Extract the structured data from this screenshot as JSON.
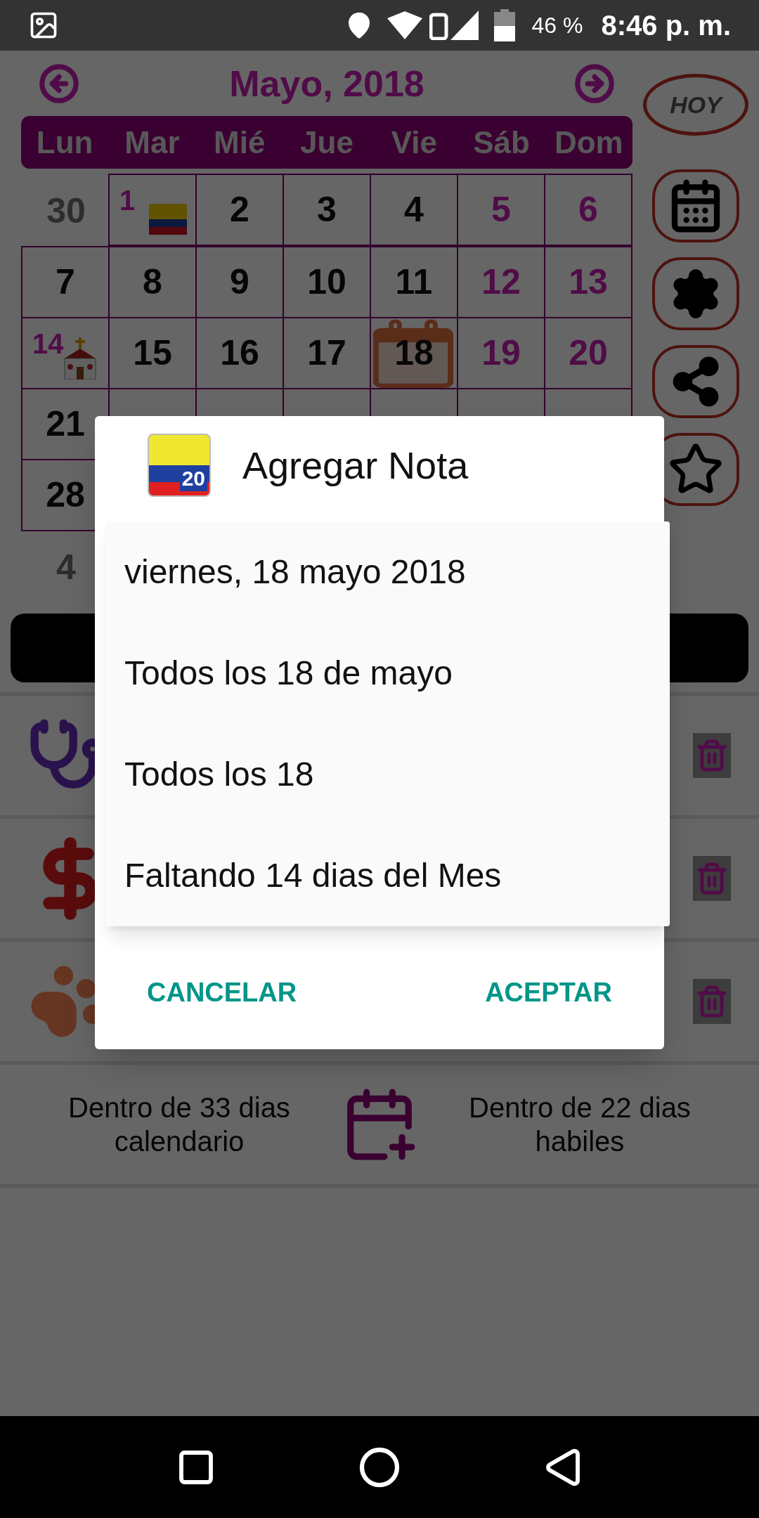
{
  "status_bar": {
    "battery": "46 %",
    "time": "8:46 p. m."
  },
  "calendar": {
    "title": "Mayo, 2018",
    "today_button": "HOY",
    "weekdays": [
      "Lun",
      "Mar",
      "Mié",
      "Jue",
      "Vie",
      "Sáb",
      "Dom"
    ],
    "weeks": [
      {
        "cells": [
          {
            "day": "30",
            "kind": "other-month",
            "selected": false
          },
          {
            "day": "1",
            "kind": "national-holiday",
            "selected": false
          },
          {
            "day": "2",
            "kind": "weekday",
            "selected": false
          },
          {
            "day": "3",
            "kind": "weekday",
            "selected": false
          },
          {
            "day": "4",
            "kind": "weekday",
            "selected": false
          },
          {
            "day": "5",
            "kind": "weekend",
            "selected": false
          },
          {
            "day": "6",
            "kind": "weekend",
            "selected": false
          }
        ]
      },
      {
        "cells": [
          {
            "day": "7",
            "kind": "weekday",
            "selected": false
          },
          {
            "day": "8",
            "kind": "weekday",
            "selected": false
          },
          {
            "day": "9",
            "kind": "weekday",
            "selected": false
          },
          {
            "day": "10",
            "kind": "weekday",
            "selected": false
          },
          {
            "day": "11",
            "kind": "weekday",
            "selected": false
          },
          {
            "day": "12",
            "kind": "weekend",
            "selected": false
          },
          {
            "day": "13",
            "kind": "weekend",
            "selected": false
          }
        ]
      },
      {
        "cells": [
          {
            "day": "14",
            "kind": "religious-holiday",
            "selected": false
          },
          {
            "day": "15",
            "kind": "weekday",
            "selected": false
          },
          {
            "day": "16",
            "kind": "weekday",
            "selected": false
          },
          {
            "day": "17",
            "kind": "weekday",
            "selected": false
          },
          {
            "day": "18",
            "kind": "weekday",
            "selected": true
          },
          {
            "day": "19",
            "kind": "weekend",
            "selected": false
          },
          {
            "day": "20",
            "kind": "weekend",
            "selected": false
          }
        ]
      },
      {
        "cells": [
          {
            "day": "21",
            "kind": "weekday",
            "selected": false
          }
        ]
      },
      {
        "cells": [
          {
            "day": "28",
            "kind": "weekday",
            "selected": false
          }
        ]
      },
      {
        "cells": [
          {
            "day": "4",
            "kind": "other-month",
            "selected": false
          }
        ]
      }
    ]
  },
  "footer": {
    "left": "Dentro de 33 dias calendario",
    "right": "Dentro de 22 dias habiles"
  },
  "dialog": {
    "icon_text": "20",
    "title": "Agregar Nota",
    "options": [
      "viernes, 18 mayo 2018",
      "Todos los 18 de mayo",
      "Todos los 18",
      "Faltando 14 dias del Mes"
    ],
    "buttons": [
      "CANCELAR",
      "ACEPTAR"
    ]
  }
}
